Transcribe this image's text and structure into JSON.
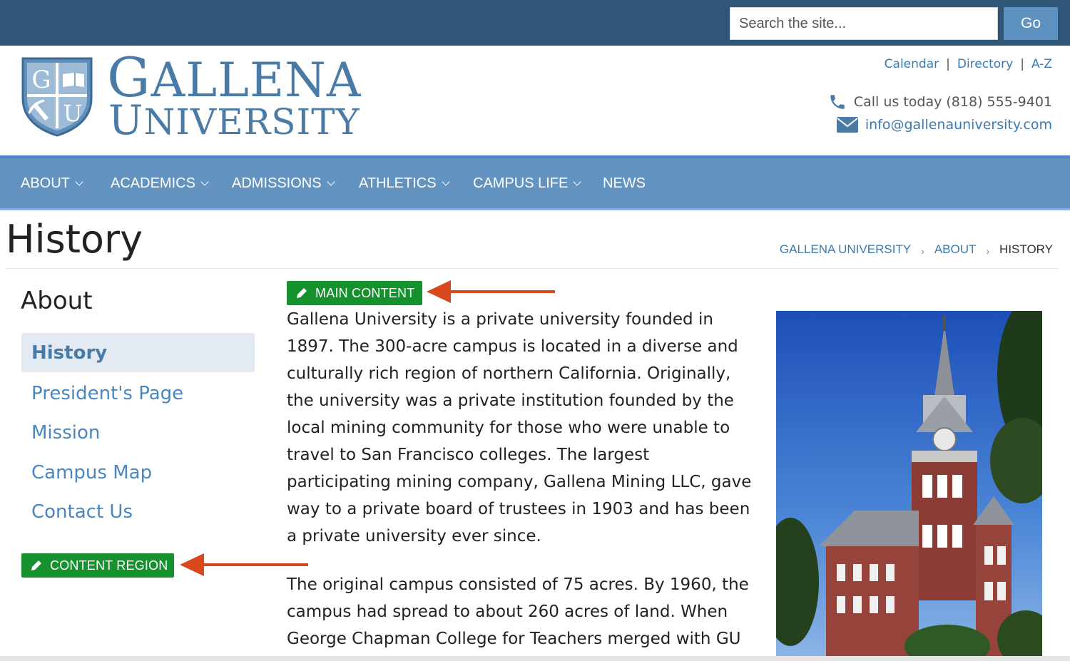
{
  "search": {
    "placeholder": "Search the site...",
    "button_label": "Go"
  },
  "logo": {
    "shield_letters": [
      "G",
      "U"
    ],
    "line1": {
      "initial": "G",
      "rest": "ALLENA"
    },
    "line2": {
      "initial": "U",
      "rest": "NIVERSITY"
    }
  },
  "utility_links": {
    "items": [
      "Calendar",
      "Directory",
      "A-Z"
    ],
    "separator": "|"
  },
  "contact": {
    "phone_text": "Call us today (818) 555-9401",
    "email": "info@gallenauniversity.com"
  },
  "nav": {
    "items": [
      {
        "label": "ABOUT",
        "has_dropdown": true
      },
      {
        "label": "ACADEMICS",
        "has_dropdown": true
      },
      {
        "label": "ADMISSIONS",
        "has_dropdown": true
      },
      {
        "label": "ATHLETICS",
        "has_dropdown": true
      },
      {
        "label": "CAMPUS LIFE",
        "has_dropdown": true
      },
      {
        "label": "NEWS",
        "has_dropdown": false
      }
    ]
  },
  "page": {
    "title": "History"
  },
  "breadcrumb": {
    "items": [
      "GALLENA UNIVERSITY",
      "ABOUT"
    ],
    "current": "HISTORY",
    "separator": "›"
  },
  "sidebar": {
    "heading": "About",
    "items": [
      {
        "label": "History",
        "active": true
      },
      {
        "label": "President's Page",
        "active": false
      },
      {
        "label": "Mission",
        "active": false
      },
      {
        "label": "Campus Map",
        "active": false
      },
      {
        "label": "Contact Us",
        "active": false
      }
    ]
  },
  "edit_buttons": {
    "main_content": "MAIN CONTENT",
    "content_region": "CONTENT REGION"
  },
  "content": {
    "paragraph1": "Gallena University is a private university founded in 1897. The 300-acre campus is located in a diverse and culturally rich region of northern California. Originally, the university was a private institution founded by the local mining community for those who were unable to travel to San Francisco colleges. The largest participating mining company, Gallena Mining LLC, gave way to a private board of trustees in 1903 and has been a private university ever since.",
    "paragraph2": "The original campus consisted of 75 acres. By 1960, the campus had spread to about 260 acres of land. When George Chapman College for Teachers merged with GU in"
  },
  "colors": {
    "topbar": "#2f5577",
    "nav": "#6393c0",
    "accent_blue": "#4a7aa6",
    "link": "#3a7ab3",
    "edit_green": "#15912d",
    "arrow": "#d9481c"
  },
  "icons": {
    "phone": "phone-icon",
    "email": "envelope-icon",
    "edit": "pencil-icon"
  }
}
